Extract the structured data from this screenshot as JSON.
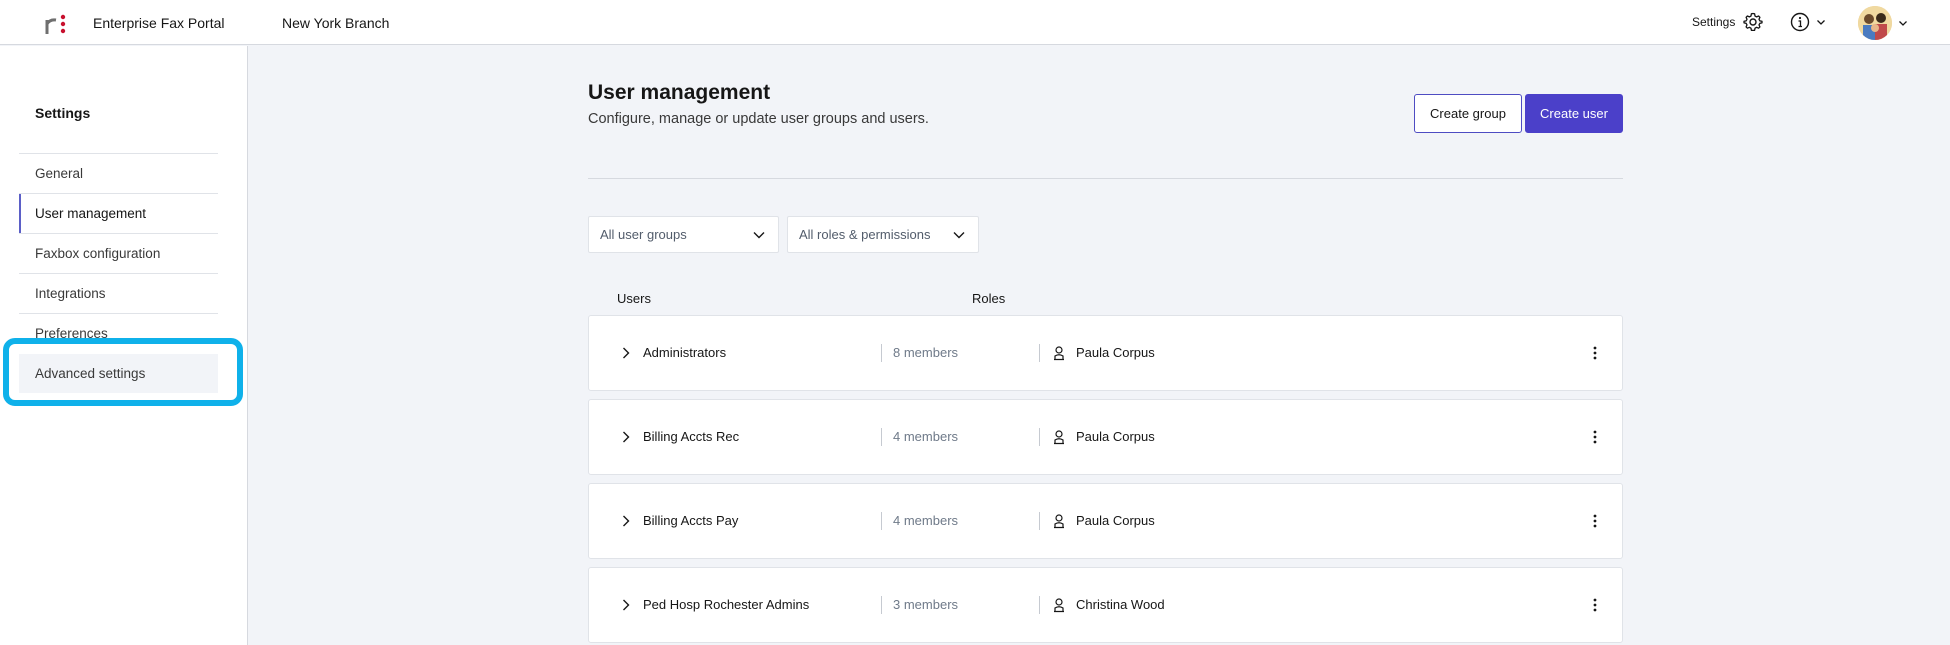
{
  "header": {
    "app_title": "Enterprise Fax Portal",
    "branch": "New York Branch",
    "settings_label": "Settings",
    "icons": {
      "logo": "r-logo",
      "settings": "gear-icon",
      "info": "info-icon",
      "avatar": "user-avatar"
    },
    "colors": {
      "logo_dot": "#c8102e"
    }
  },
  "sidebar": {
    "title": "Settings",
    "items": [
      {
        "label": "General"
      },
      {
        "label": "User management"
      },
      {
        "label": "Faxbox configuration"
      },
      {
        "label": "Integrations"
      },
      {
        "label": "Preferences"
      },
      {
        "label": "Advanced settings"
      }
    ],
    "active_item": "User management",
    "highlighted_item": "Advanced settings",
    "colors": {
      "highlight": "#0fb1ea",
      "active_indicator": "#5b5fc7"
    }
  },
  "main": {
    "title": "User management",
    "subtitle": "Configure, manage or update user groups and users.",
    "buttons": {
      "create_group": "Create group",
      "create_user": "Create user"
    },
    "filters": {
      "groups": "All user groups",
      "roles": "All roles & permissions"
    },
    "table": {
      "headers": {
        "users": "Users",
        "roles": "Roles"
      },
      "rows": [
        {
          "name": "Administrators",
          "members": "8 members",
          "role": "Paula Corpus"
        },
        {
          "name": "Billing Accts Rec",
          "members": "4 members",
          "role": "Paula Corpus"
        },
        {
          "name": "Billing Accts Pay",
          "members": "4 members",
          "role": "Paula Corpus"
        },
        {
          "name": "Ped Hosp Rochester Admins",
          "members": "3 members",
          "role": "Christina Wood"
        }
      ]
    },
    "colors": {
      "primary": "#4b40c9"
    }
  }
}
